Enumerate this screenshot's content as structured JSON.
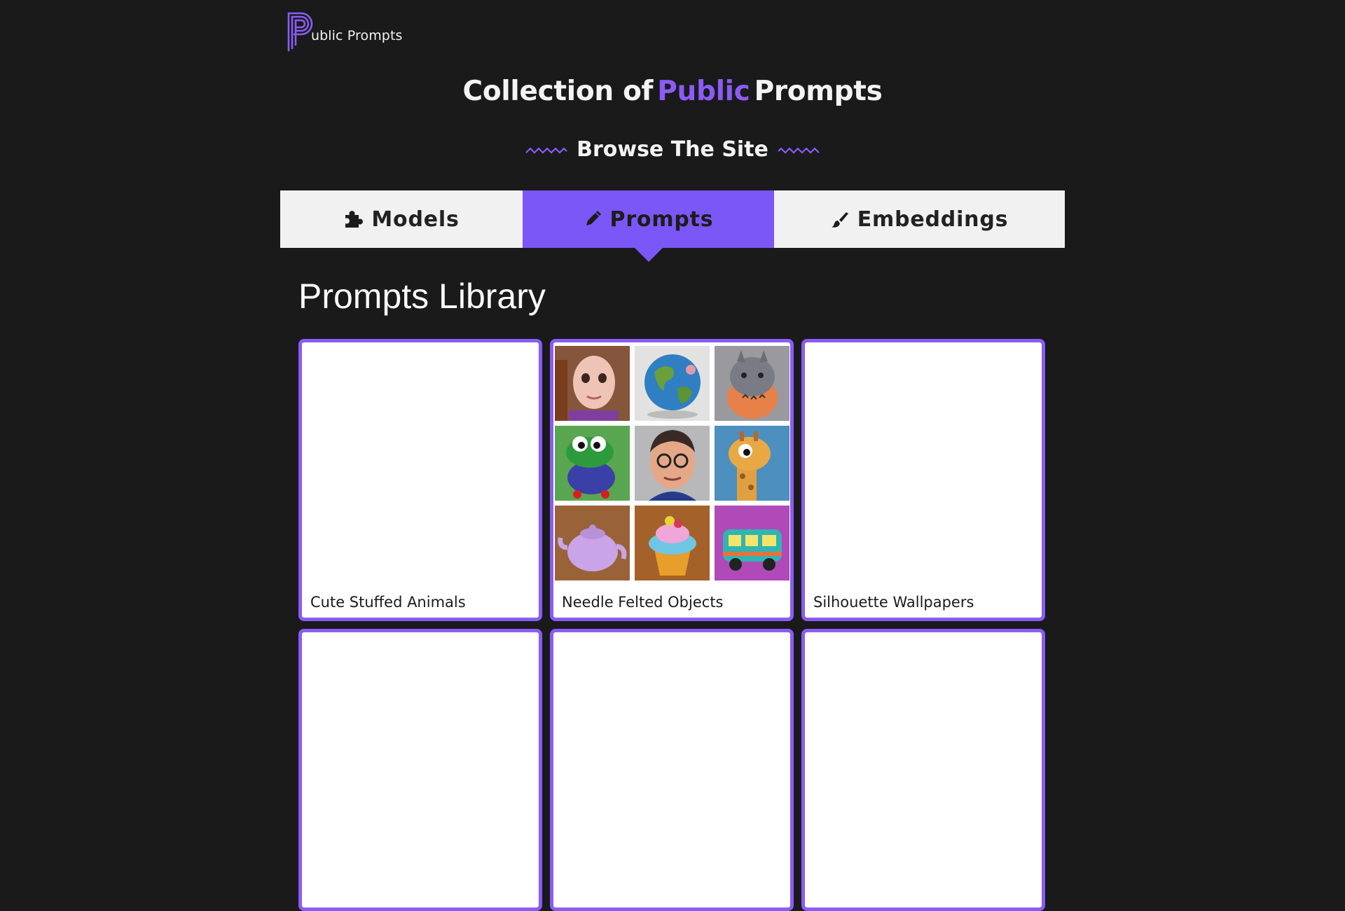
{
  "logo": {
    "text": "ublic Prompts",
    "letter": "P"
  },
  "hero": {
    "title_before": "Collection of",
    "title_accent": "Public",
    "title_after": "Prompts"
  },
  "browse": {
    "label": "Browse The Site"
  },
  "tabs": [
    {
      "label": "Models",
      "icon": "puzzle-icon",
      "active": false
    },
    {
      "label": "Prompts",
      "icon": "pencil-icon",
      "active": true
    },
    {
      "label": "Embeddings",
      "icon": "brush-icon",
      "active": false
    }
  ],
  "library": {
    "title": "Prompts Library",
    "cards": [
      {
        "title": "Cute Stuffed Animals"
      },
      {
        "title": "Needle Felted Objects",
        "thumbnails": [
          "felted-girl",
          "felted-globe",
          "felted-totoro",
          "felted-frog",
          "felted-man",
          "felted-giraffe",
          "felted-teapot",
          "felted-cupcake",
          "felted-van"
        ]
      },
      {
        "title": "Silhouette Wallpapers"
      },
      {
        "title": ""
      },
      {
        "title": ""
      },
      {
        "title": ""
      }
    ]
  },
  "colors": {
    "accent": "#8a5cf5",
    "tab_active": "#7c57f7",
    "background": "#1a1a1b",
    "tab_bg": "#f1f1f1"
  }
}
